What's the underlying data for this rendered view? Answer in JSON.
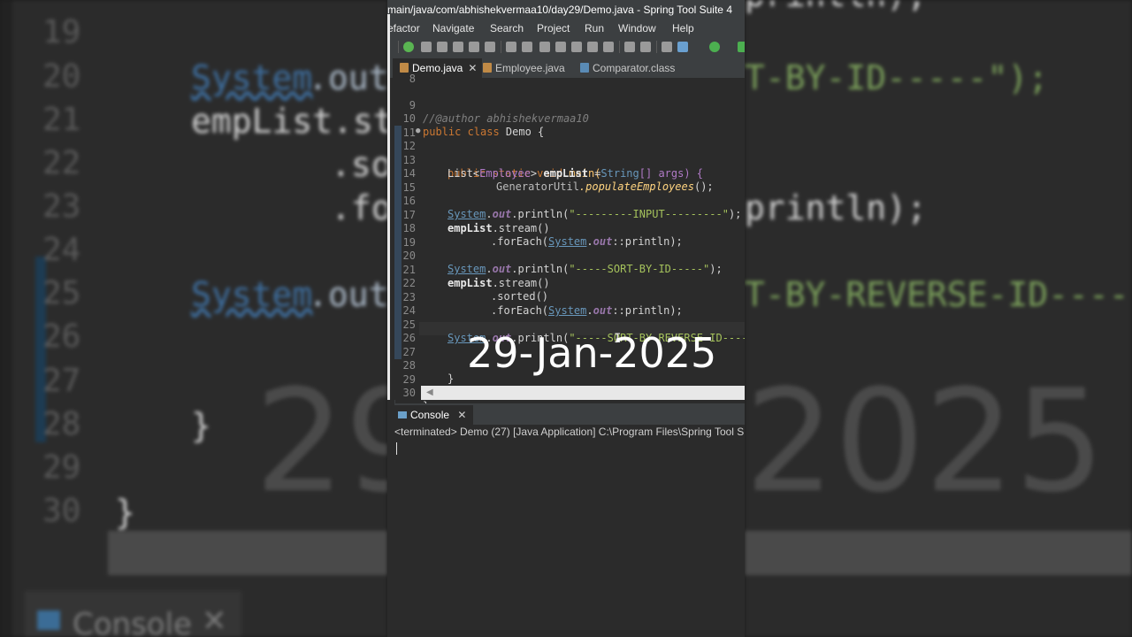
{
  "window": {
    "title": "main/java/com/abhishekvermaa10/day29/Demo.java - Spring Tool Suite 4"
  },
  "menu": [
    "efactor",
    "Navigate",
    "Search",
    "Project",
    "Run",
    "Window",
    "Help"
  ],
  "tabs": [
    {
      "label": "Demo.java",
      "icon": "java-file-icon",
      "active": true,
      "close": "✕"
    },
    {
      "label": "Employee.java",
      "icon": "java-file-icon",
      "active": false
    },
    {
      "label": "Comparator.class",
      "icon": "class-file-icon",
      "active": false
    }
  ],
  "editor": {
    "line_numbers": [
      "8",
      "9",
      "10",
      "11",
      "12",
      "13",
      "14",
      "15",
      "16",
      "17",
      "18",
      "19",
      "20",
      "21",
      "22",
      "23",
      "24",
      "25",
      "26",
      "27",
      "28",
      "29",
      "30"
    ],
    "code": {
      "l9": "//@author abhishekvermaa10",
      "l10_kw": "public class",
      "l10_name": " Demo {",
      "l12_kw": "public static void",
      "l12_rest_main": " main(",
      "l12_string": "String",
      "l12_args": "[] args) {",
      "l13_list": "List<",
      "l13_employee": "Employee",
      "l13_close": "> ",
      "l13_var": "empList",
      "l13_eq": " =",
      "l14_util": "GeneratorUtil",
      "l14_method": ".populateEmployees",
      "l14_end": "();",
      "sys": "System",
      "dot": ".",
      "out": "out",
      "println_open": ".println(",
      "l16_str": "\"---------INPUT---------\"",
      "end_paren": ");",
      "l17_var": "empList",
      "l17_rest": ".stream()",
      "l18_a": ".forEach(",
      "l18_b": "::println);",
      "l20_str": "\"-----SORT-BY-ID-----\"",
      "l21_var": "empList",
      "l21_rest": ".stream()",
      "l22": ".sorted()",
      "l23_a": ".forEach(",
      "l23_b": "::println);",
      "l25_str": "\"-----SORT-BY-REVERSE-ID----",
      "l28": "}",
      "l30": "}"
    },
    "overlay_date": "29-Jan-2025"
  },
  "console": {
    "tab_label": "Console",
    "close": "✕",
    "status": "<terminated> Demo (27) [Java Application] C:\\Program Files\\Spring Tool Suit"
  },
  "background": {
    "left_lines": [
      "19",
      "20",
      "21",
      "22",
      "23",
      "24",
      "25",
      "26",
      "27",
      "28",
      "29",
      "30"
    ],
    "code_system": "System",
    "code_out": ".out",
    "code_emplist": "empList.st",
    "code_so": ".so",
    "code_fo": ".fo",
    "code_brace": "}",
    "date_left": "29",
    "date_right": "2025",
    "right_sort": "T-BY-ID-----\");",
    "right_println": "println);",
    "right_reverse": "T-BY-REVERSE-ID-----",
    "right_top": "println);",
    "console_label": "Console",
    "console_x": "✕"
  }
}
